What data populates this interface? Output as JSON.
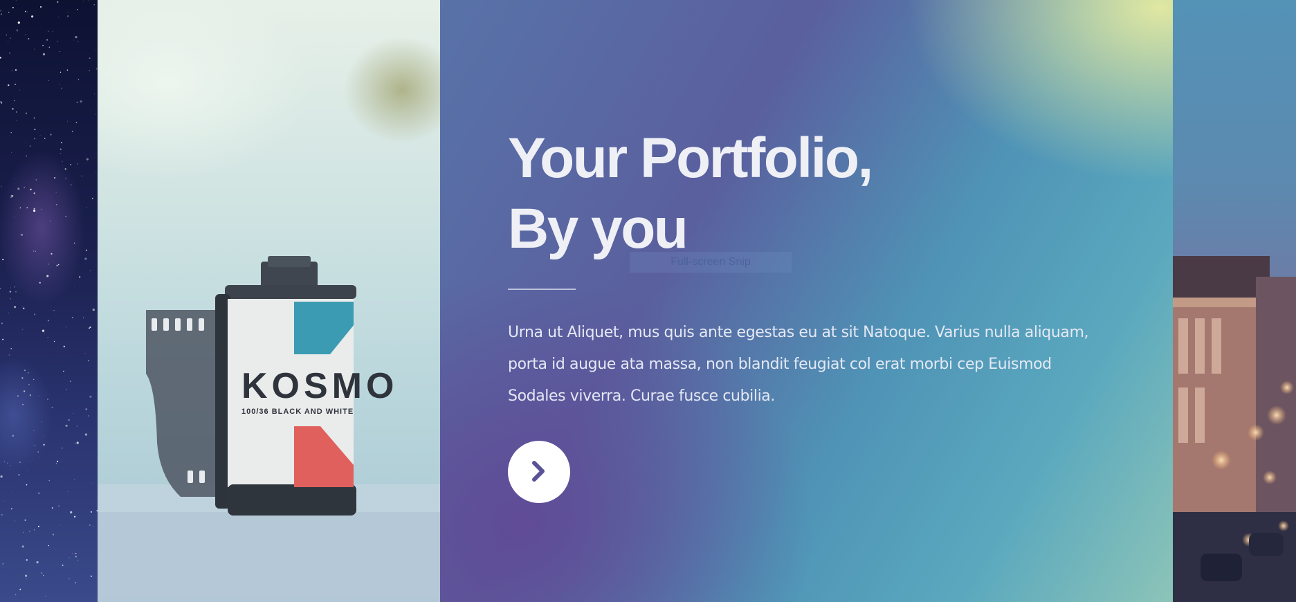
{
  "hero": {
    "title_line1": "Your Portfolio,",
    "title_line2": "By you",
    "body": "Urna ut Aliquet, mus quis ante egestas eu at sit Natoque. Varius nulla aliquam, porta id augue ata massa, non blandit feugiat col erat morbi cep Euismod Sodales viverra. Curae fusce cubilia.",
    "next_button_icon": "chevron-right-icon"
  },
  "film": {
    "brand": "KOSMO",
    "subtitle": "100/36 BLACK AND WHITE"
  },
  "overlay": {
    "snip_label": "Full-screen Snip"
  },
  "colors": {
    "accent": "#5a5296",
    "title": "#eef0f6",
    "button_bg": "#ffffff"
  }
}
